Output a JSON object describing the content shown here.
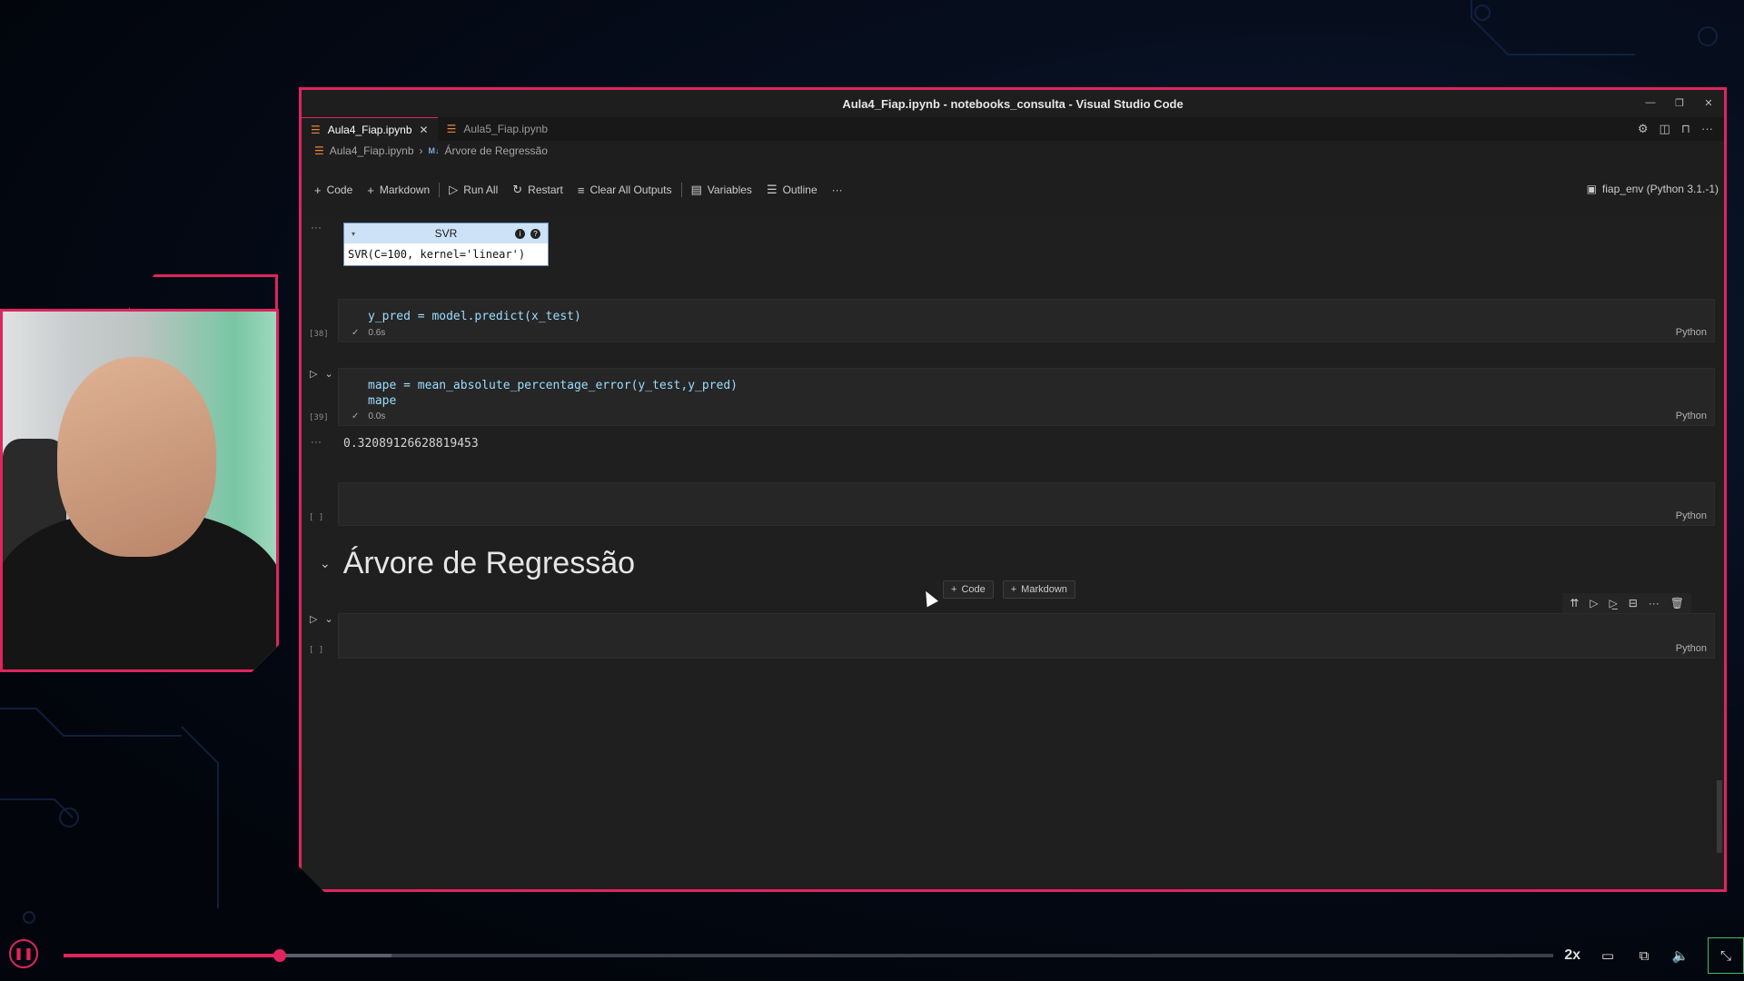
{
  "window": {
    "title": "Aula4_Fiap.ipynb - notebooks_consulta - Visual Studio Code"
  },
  "tabs": [
    {
      "label": "Aula4_Fiap.ipynb",
      "active": true
    },
    {
      "label": "Aula5_Fiap.ipynb",
      "active": false
    }
  ],
  "breadcrumb": {
    "file": "Aula4_Fiap.ipynb",
    "badge": "M↓",
    "section": "Árvore de Regressão"
  },
  "toolbar": {
    "code": "Code",
    "markdown": "Markdown",
    "run_all": "Run All",
    "restart": "Restart",
    "clear_all": "Clear All Outputs",
    "variables": "Variables",
    "outline": "Outline",
    "more": "···",
    "kernel": "fiap_env (Python 3.1.-1)"
  },
  "cells": {
    "svr_output": {
      "head": "SVR",
      "body": "SVR(C=100, kernel='linear')"
    },
    "cell38": {
      "line1": "y_pred = model.predict(x_test)",
      "count": "[38]",
      "time": "0.6s",
      "lang": "Python"
    },
    "cell39": {
      "line1": "mape = mean_absolute_percentage_error(y_test,y_pred)",
      "line2": "mape",
      "count": "[39]",
      "time": "0.0s",
      "lang": "Python",
      "output": "0.32089126628819453"
    },
    "empty1": {
      "count": "[ ]",
      "lang": "Python"
    },
    "heading": "Árvore de Regressão",
    "empty2": {
      "count": "[ ]",
      "lang": "Python"
    }
  },
  "insert": {
    "code": "Code",
    "markdown": "Markdown"
  },
  "player": {
    "speed": "2x",
    "played": 0.145,
    "buffered": 0.22
  },
  "colors": {
    "accent": "#e0245e",
    "editor_bg": "#1f1f1f"
  }
}
